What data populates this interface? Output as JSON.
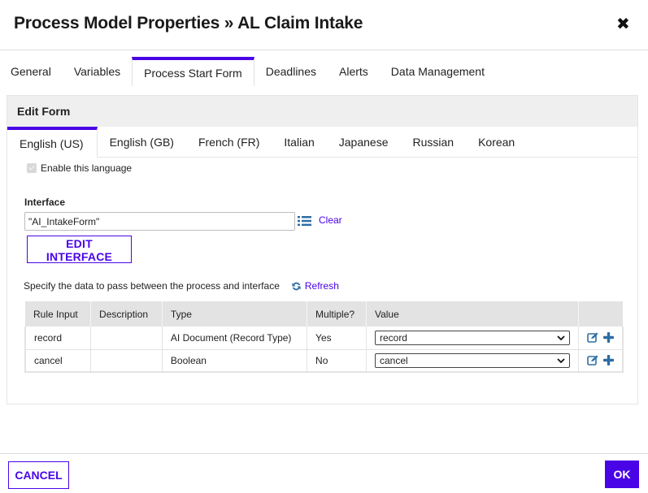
{
  "dialog": {
    "title": "Process Model Properties » AL Claim Intake",
    "close_icon": "close-x-icon"
  },
  "main_tabs": [
    {
      "label": "General",
      "active": false
    },
    {
      "label": "Variables",
      "active": false
    },
    {
      "label": "Process Start Form",
      "active": true
    },
    {
      "label": "Deadlines",
      "active": false
    },
    {
      "label": "Alerts",
      "active": false
    },
    {
      "label": "Data Management",
      "active": false
    }
  ],
  "edit_form": {
    "header": "Edit Form",
    "language_tabs": [
      {
        "label": "English (US)",
        "active": true
      },
      {
        "label": "English (GB)",
        "active": false
      },
      {
        "label": "French (FR)",
        "active": false
      },
      {
        "label": "Italian",
        "active": false
      },
      {
        "label": "Japanese",
        "active": false
      },
      {
        "label": "Russian",
        "active": false
      },
      {
        "label": "Korean",
        "active": false
      }
    ],
    "enable_language": {
      "label": "Enable this language",
      "checked": true,
      "disabled": true
    },
    "interface": {
      "label": "Interface",
      "value": "\"AI_IntakeForm\"",
      "browse_icon": "list-icon",
      "clear_label": "Clear"
    },
    "edit_interface_label": "EDIT INTERFACE",
    "specify_text": "Specify the data to pass between the process and interface",
    "refresh_label": "Refresh",
    "table": {
      "headers": [
        "Rule Input",
        "Description",
        "Type",
        "Multiple?",
        "Value",
        ""
      ],
      "rows": [
        {
          "rule_input": "record",
          "description": "",
          "type": "AI Document (Record Type)",
          "multiple": "Yes",
          "value": "record"
        },
        {
          "rule_input": "cancel",
          "description": "",
          "type": "Boolean",
          "multiple": "No",
          "value": "cancel"
        }
      ]
    }
  },
  "footer": {
    "cancel_label": "CANCEL",
    "ok_label": "OK"
  },
  "colors": {
    "accent": "#4a05e6",
    "icon_blue": "#2e6da4",
    "header_bg": "#efefef",
    "table_header_bg": "#e3e3e3"
  }
}
